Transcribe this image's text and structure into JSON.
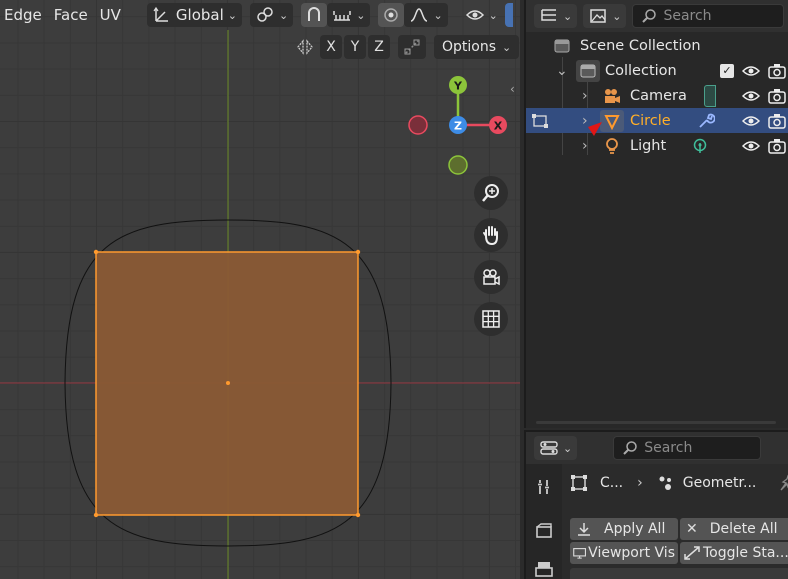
{
  "viewport": {
    "menus": [
      "Edge",
      "Face",
      "UV"
    ],
    "orientation": "Global",
    "axes": [
      "X",
      "Y",
      "Z"
    ],
    "options_label": "Options",
    "gizmo": {
      "y": "Y",
      "x": "X",
      "z": "Z"
    }
  },
  "outliner": {
    "search_placeholder": "Search",
    "items": [
      {
        "label": "Scene Collection"
      },
      {
        "label": "Collection"
      },
      {
        "label": "Camera"
      },
      {
        "label": "Circle"
      },
      {
        "label": "Light"
      }
    ]
  },
  "properties": {
    "search_placeholder": "Search",
    "breadcrumb_object": "C...",
    "breadcrumb_modifier": "Geometr...",
    "apply_all": "Apply All",
    "delete_all": "Delete All",
    "viewport_vis": "Viewport Vis",
    "toggle_stack": "Toggle Sta..."
  },
  "colors": {
    "selection": "#334d80",
    "active_object": "#ffaf29",
    "face_fill": "#8a5a35",
    "edge_select": "#ff9a2e"
  }
}
